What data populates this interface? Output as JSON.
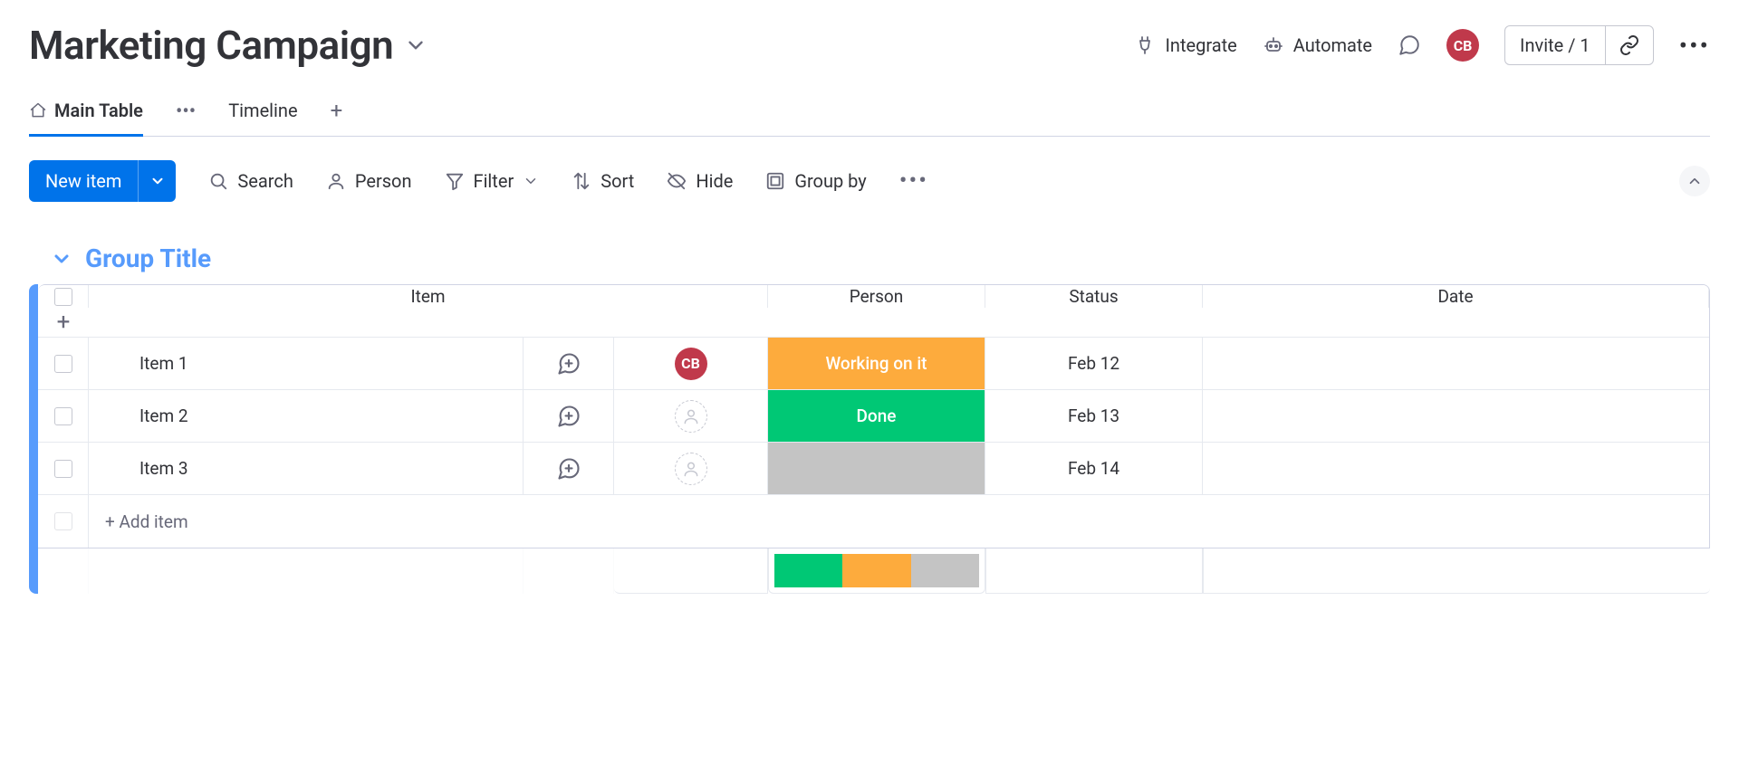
{
  "header": {
    "title": "Marketing Campaign",
    "integrate": "Integrate",
    "automate": "Automate",
    "avatarInitials": "CB",
    "inviteLabel": "Invite / 1"
  },
  "views": {
    "mainTable": "Main Table",
    "timeline": "Timeline"
  },
  "toolbar": {
    "newItem": "New item",
    "search": "Search",
    "person": "Person",
    "filter": "Filter",
    "sort": "Sort",
    "hide": "Hide",
    "groupBy": "Group by"
  },
  "group": {
    "title": "Group Title",
    "accentColor": "#579bfc",
    "columns": {
      "item": "Item",
      "person": "Person",
      "status": "Status",
      "date": "Date"
    },
    "rows": [
      {
        "item": "Item 1",
        "personInitials": "CB",
        "personAssigned": true,
        "status": "Working on it",
        "statusClass": "status-working",
        "date": "Feb 12"
      },
      {
        "item": "Item 2",
        "personInitials": "",
        "personAssigned": false,
        "status": "Done",
        "statusClass": "status-done",
        "date": "Feb 13"
      },
      {
        "item": "Item 3",
        "personInitials": "",
        "personAssigned": false,
        "status": "",
        "statusClass": "status-empty",
        "date": "Feb 14"
      }
    ],
    "addItem": "+ Add item",
    "summaryColors": [
      "#00c875",
      "#fdab3d",
      "#c4c4c4"
    ]
  }
}
